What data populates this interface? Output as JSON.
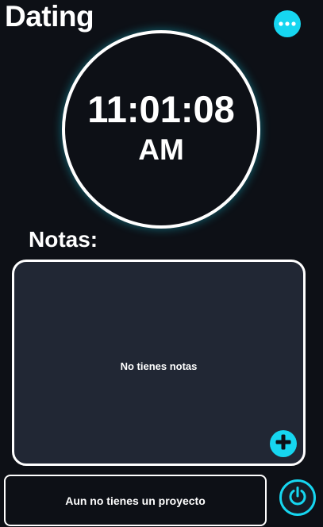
{
  "header": {
    "title": "Dating",
    "menu_icon": "more-dots-icon"
  },
  "clock": {
    "time": "11:01:08",
    "period": "AM"
  },
  "notes": {
    "heading": "Notas:",
    "empty_message": "No tienes notas",
    "add_icon": "plus-icon"
  },
  "project": {
    "status": "Aun no tienes un proyecto"
  },
  "power": {
    "icon": "power-icon"
  },
  "colors": {
    "background": "#0d1016",
    "panel": "#212734",
    "accent": "#16d6f0",
    "text": "#ffffff"
  }
}
